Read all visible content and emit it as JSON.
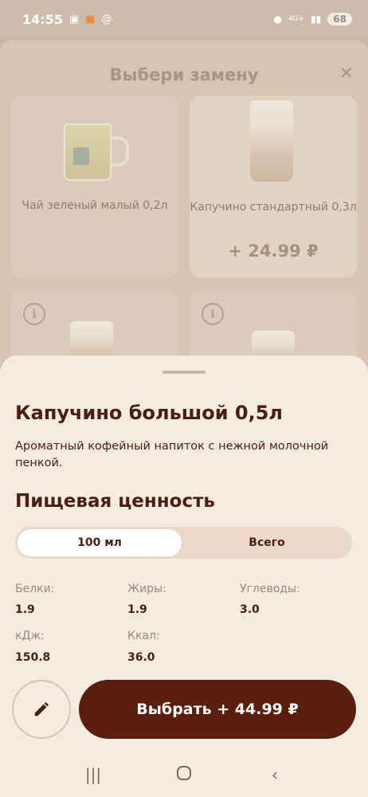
{
  "status_bar": {
    "time": "14:55",
    "network": "4G+",
    "battery": "68"
  },
  "replacement_modal": {
    "title": "Выбери замену",
    "close_icon": "close-icon",
    "cards": [
      {
        "name": "Чай зеленый малый 0,2л",
        "price": ""
      },
      {
        "name": "Капучино стандартный 0,3л",
        "price": "+ 24.99 ₽"
      },
      {
        "name": "",
        "price": ""
      },
      {
        "name": "",
        "price": ""
      }
    ]
  },
  "product": {
    "title": "Капучино большой 0,5л",
    "description": "Ароматный кофейный напиток с нежной молочной пенкой."
  },
  "nutrition": {
    "title": "Пищевая ценность",
    "tabs": [
      {
        "label": "100 мл",
        "active": true
      },
      {
        "label": "Всего",
        "active": false
      }
    ],
    "facts": [
      {
        "label": "Белки:",
        "value": "1.9"
      },
      {
        "label": "Жиры:",
        "value": "1.9"
      },
      {
        "label": "Углеводы:",
        "value": "3.0"
      },
      {
        "label": "кДж:",
        "value": "150.8"
      },
      {
        "label": "Ккал:",
        "value": "36.0"
      }
    ]
  },
  "actions": {
    "edit_icon": "pencil-icon",
    "select_label": "Выбрать + 44.99 ₽"
  },
  "colors": {
    "primary": "#5a1e0d",
    "sheet_bg": "#f5ebe1",
    "text": "#4b1f10"
  }
}
